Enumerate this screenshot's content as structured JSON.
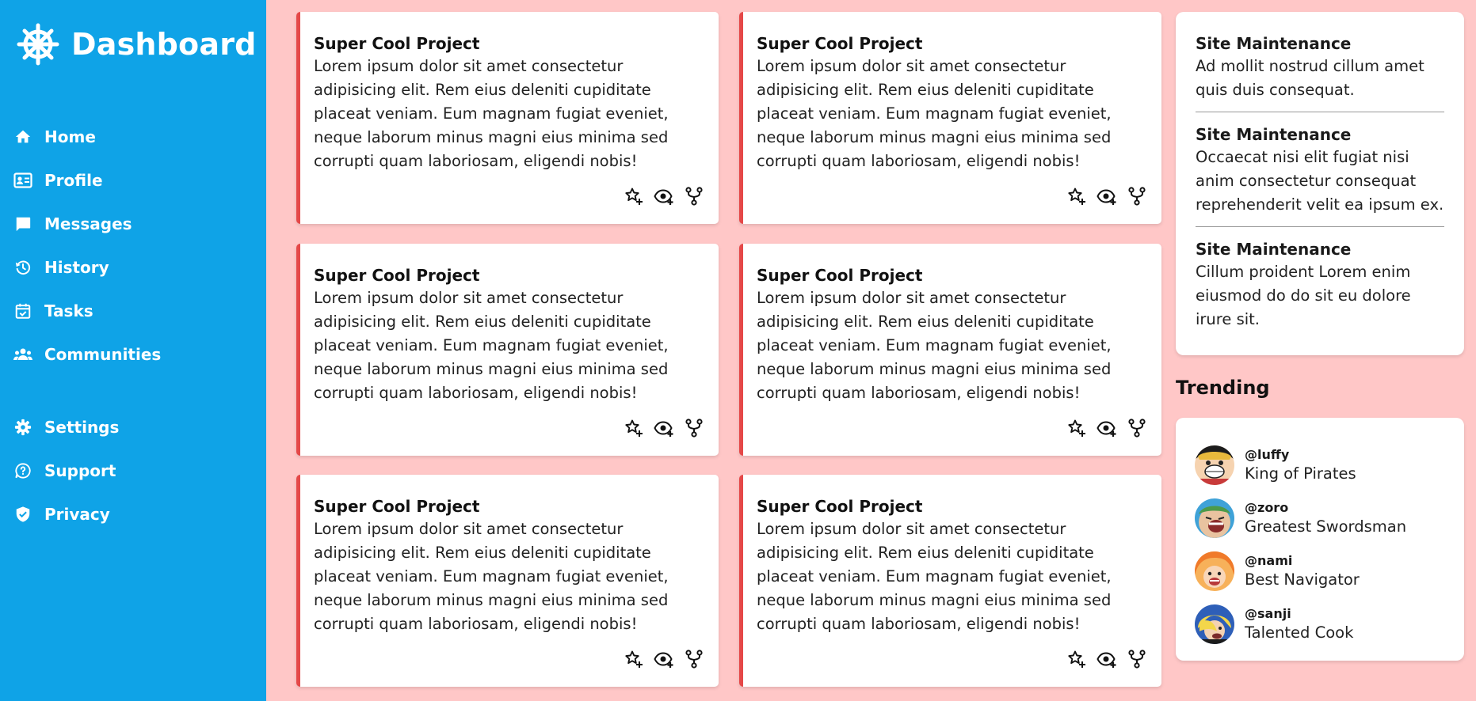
{
  "sidebar": {
    "brand": {
      "title": "Dashboard",
      "icon": "ship-wheel-icon"
    },
    "main_items": [
      {
        "label": "Home",
        "icon": "home-icon"
      },
      {
        "label": "Profile",
        "icon": "id-card-icon"
      },
      {
        "label": "Messages",
        "icon": "chat-icon"
      },
      {
        "label": "History",
        "icon": "history-icon"
      },
      {
        "label": "Tasks",
        "icon": "calendar-check-icon"
      },
      {
        "label": "Communities",
        "icon": "group-icon"
      }
    ],
    "secondary_items": [
      {
        "label": "Settings",
        "icon": "gear-icon"
      },
      {
        "label": "Support",
        "icon": "help-icon"
      },
      {
        "label": "Privacy",
        "icon": "shield-icon"
      }
    ]
  },
  "projects": [
    {
      "title": "Super Cool Project",
      "body": "Lorem ipsum dolor sit amet consectetur adipisicing elit. Rem eius deleniti cupiditate placeat veniam. Eum magnam fugiat eveniet, neque laborum minus magni eius minima sed corrupti quam laboriosam, eligendi nobis!"
    },
    {
      "title": "Super Cool Project",
      "body": "Lorem ipsum dolor sit amet consectetur adipisicing elit. Rem eius deleniti cupiditate placeat veniam. Eum magnam fugiat eveniet, neque laborum minus magni eius minima sed corrupti quam laboriosam, eligendi nobis!"
    },
    {
      "title": "Super Cool Project",
      "body": "Lorem ipsum dolor sit amet consectetur adipisicing elit. Rem eius deleniti cupiditate placeat veniam. Eum magnam fugiat eveniet, neque laborum minus magni eius minima sed corrupti quam laboriosam, eligendi nobis!"
    },
    {
      "title": "Super Cool Project",
      "body": "Lorem ipsum dolor sit amet consectetur adipisicing elit. Rem eius deleniti cupiditate placeat veniam. Eum magnam fugiat eveniet, neque laborum minus magni eius minima sed corrupti quam laboriosam, eligendi nobis!"
    },
    {
      "title": "Super Cool Project",
      "body": "Lorem ipsum dolor sit amet consectetur adipisicing elit. Rem eius deleniti cupiditate placeat veniam. Eum magnam fugiat eveniet, neque laborum minus magni eius minima sed corrupti quam laboriosam, eligendi nobis!"
    },
    {
      "title": "Super Cool Project",
      "body": "Lorem ipsum dolor sit amet consectetur adipisicing elit. Rem eius deleniti cupiditate placeat veniam. Eum magnam fugiat eveniet, neque laborum minus magni eius minima sed corrupti quam laboriosam, eligendi nobis!"
    }
  ],
  "project_actions": [
    {
      "icon": "star-plus-icon"
    },
    {
      "icon": "eye-plus-icon"
    },
    {
      "icon": "fork-icon"
    }
  ],
  "announcements": [
    {
      "title": "Site Maintenance",
      "body": "Ad mollit nostrud cillum amet quis duis consequat."
    },
    {
      "title": "Site Maintenance",
      "body": "Occaecat nisi elit fugiat nisi anim consectetur consequat reprehenderit velit ea ipsum ex."
    },
    {
      "title": "Site Maintenance",
      "body": "Cillum proident Lorem enim eiusmod do do sit eu dolore irure sit."
    }
  ],
  "trending": {
    "heading": "Trending",
    "users": [
      {
        "handle": "@luffy",
        "caption": "King of Pirates",
        "avatar": "luffy-avatar"
      },
      {
        "handle": "@zoro",
        "caption": "Greatest Swordsman",
        "avatar": "zoro-avatar"
      },
      {
        "handle": "@nami",
        "caption": "Best Navigator",
        "avatar": "nami-avatar"
      },
      {
        "handle": "@sanji",
        "caption": "Talented Cook",
        "avatar": "sanji-avatar"
      }
    ]
  },
  "colors": {
    "sidebar": "#0fa3e7",
    "background": "#ffc7c7",
    "card_accent": "#e54848"
  }
}
